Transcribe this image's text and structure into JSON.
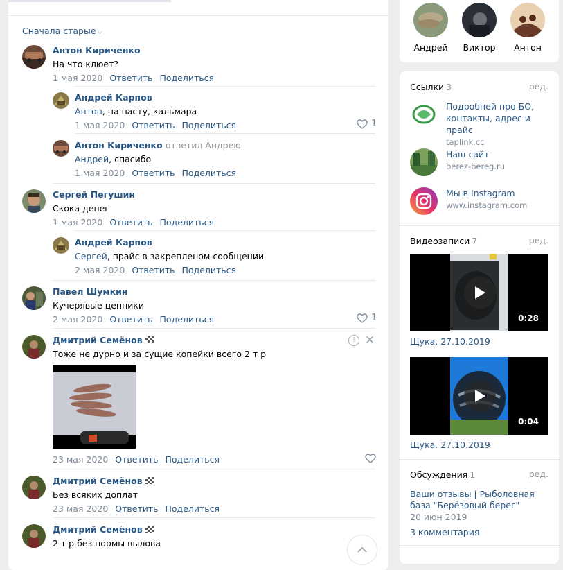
{
  "comments_panel": {
    "sort_label": "Сначала старые",
    "actions": {
      "reply": "Ответить",
      "share": "Поделиться"
    },
    "comments": [
      {
        "author": "Антон Кириченко",
        "text": "На что клюет?",
        "date": "1 мая 2020"
      },
      {
        "author": "Андрей Карпов",
        "mention": "Антон",
        "text": ", на пасту, кальмара",
        "date": "1 мая 2020",
        "likes": "1"
      },
      {
        "author": "Антон Кириченко",
        "replied_to": "ответил Андрею",
        "mention": "Андрей",
        "text": ", спасибо",
        "date": "1 мая 2020"
      },
      {
        "author": "Сергей Пегушин",
        "text": "Скока денег",
        "date": "1 мая 2020"
      },
      {
        "author": "Андрей Карпов",
        "mention": "Сергей",
        "text": ", прайс в закрепленом сообщении",
        "date": "2 мая 2020"
      },
      {
        "author": "Павел Шумкин",
        "text": "Кучерявые ценники",
        "date": "2 мая 2020",
        "likes": "1"
      },
      {
        "author": "Дмитрий Семёнов",
        "text": "Тоже не дурно и за сущие копейки всего 2 т р",
        "date": "23 мая 2020"
      },
      {
        "author": "Дмитрий Семёнов",
        "text": "Без всяких доплат",
        "date": "23 мая 2020"
      },
      {
        "author": "Дмитрий Семёнов",
        "text": "2 т р без нормы вылова"
      }
    ]
  },
  "friends": [
    {
      "name": "Андрей"
    },
    {
      "name": "Виктор"
    },
    {
      "name": "Антон"
    }
  ],
  "links": {
    "title": "Ссылки",
    "count": "3",
    "edit": "ред.",
    "items": [
      {
        "title": "Подробней про БО, контакты, адрес и прайс",
        "url": "taplink.cc"
      },
      {
        "title": "Наш сайт",
        "url": "berez-bereg.ru"
      },
      {
        "title": "Мы в Instagram",
        "url": "www.instagram.com"
      }
    ]
  },
  "videos": {
    "title": "Видеозаписи",
    "count": "7",
    "edit": "ред.",
    "items": [
      {
        "caption": "Щука. 27.10.2019",
        "duration": "0:28"
      },
      {
        "caption": "Щука. 27.10.2019",
        "duration": "0:04"
      }
    ]
  },
  "discussions": {
    "title": "Обсуждения",
    "count": "1",
    "edit": "ред.",
    "topic": "Ваши отзывы | Рыболовная база \"Берёзовый берег\"",
    "date": "20 июн 2019",
    "comments": "3 комментария"
  },
  "colors": {
    "link": "#2a5885",
    "muted": "#818c99",
    "bg": "#edeef0"
  }
}
